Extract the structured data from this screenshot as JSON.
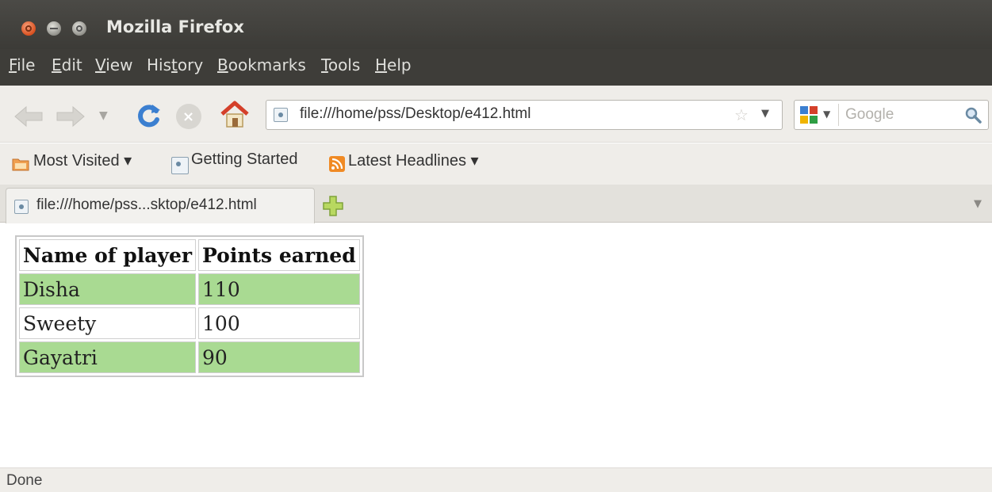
{
  "window": {
    "title": "Mozilla Firefox"
  },
  "menu": [
    {
      "label": "File"
    },
    {
      "label": "Edit"
    },
    {
      "label": "View"
    },
    {
      "label": "History"
    },
    {
      "label": "Bookmarks"
    },
    {
      "label": "Tools"
    },
    {
      "label": "Help"
    }
  ],
  "navigation": {
    "url": "file:///home/pss/Desktop/e412.html",
    "search_placeholder": "Google"
  },
  "bookmarks": [
    {
      "label": "Most Visited ▾",
      "icon": "folder-icon"
    },
    {
      "label": "Getting Started",
      "icon": "page-icon"
    },
    {
      "label": "Latest Headlines ▾",
      "icon": "rss-icon"
    }
  ],
  "tabs": [
    {
      "label": "file:///home/pss...sktop/e412.html"
    }
  ],
  "table": {
    "headers": [
      "Name of player",
      "Points earned"
    ],
    "rows": [
      {
        "name": "Disha",
        "points": "110",
        "highlight": true
      },
      {
        "name": "Sweety",
        "points": "100",
        "highlight": false
      },
      {
        "name": "Gayatri",
        "points": "90",
        "highlight": true
      }
    ]
  },
  "status": {
    "text": "Done"
  },
  "colors": {
    "highlight_row": "#a9da92",
    "titlebar": "#3c3b37"
  }
}
